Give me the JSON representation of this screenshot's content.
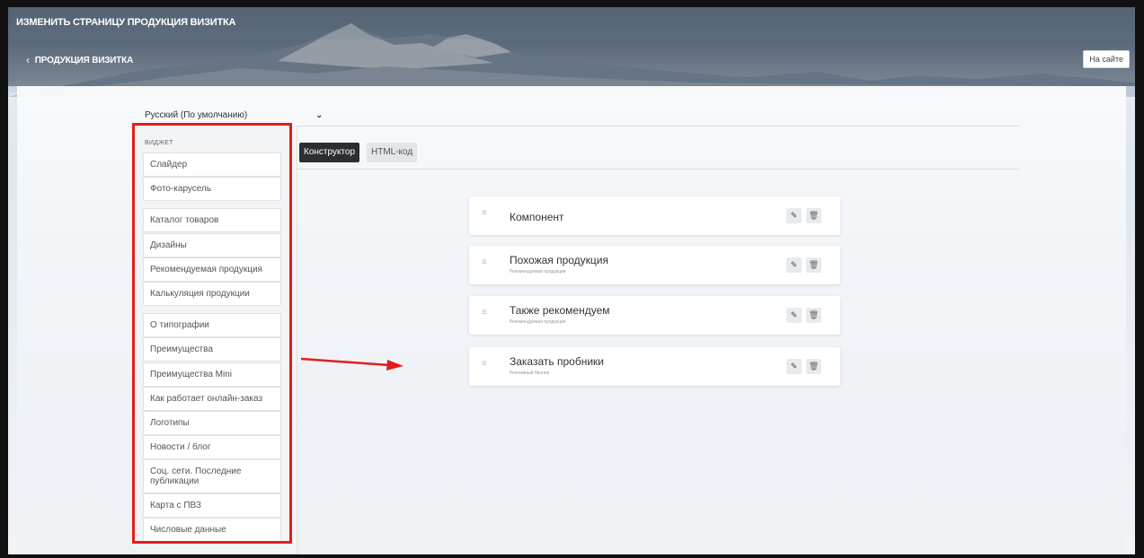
{
  "header": {
    "title": "ИЗМЕНИТЬ СТРАНИЦУ ПРОДУКЦИЯ ВИЗИТКА",
    "back_label": "ПРОДУКЦИЯ ВИЗИТКА",
    "site_button": "На сайте"
  },
  "language": {
    "selected": "Русский (По умолчанию)"
  },
  "sidebar": {
    "heading": "ВИДЖЕТ",
    "items": [
      "Слайдер",
      "Фото-карусель",
      "Каталог товаров",
      "Дизайны",
      "Рекомендуемая продукция",
      "Калькуляция продукции",
      "О типографии",
      "Преимущества",
      "Преимущества Mini",
      "Как работает онлайн-заказ",
      "Логотипы",
      "Новости / блог",
      "Соц. сети. Последние публикации",
      "Карта с ПВЗ",
      "Числовые данные"
    ]
  },
  "tabs": {
    "constructor": "Конструктор",
    "html": "HTML-код"
  },
  "components": [
    {
      "title": "Компонент",
      "subtitle": ""
    },
    {
      "title": "Похожая продукция",
      "subtitle": "Рекомендуемая продукция"
    },
    {
      "title": "Также рекомендуем",
      "subtitle": "Рекомендуемая продукция"
    },
    {
      "title": "Заказать пробники",
      "subtitle": "Рекламный баннер"
    }
  ],
  "icons": {
    "drag": "drag-handle-icon",
    "edit": "pencil-icon",
    "delete": "trash-icon",
    "back": "chevron-left-icon",
    "select": "chevron-down-icon"
  },
  "colors": {
    "highlight": "#e51c1c",
    "active_tab": "#2b2f33"
  }
}
